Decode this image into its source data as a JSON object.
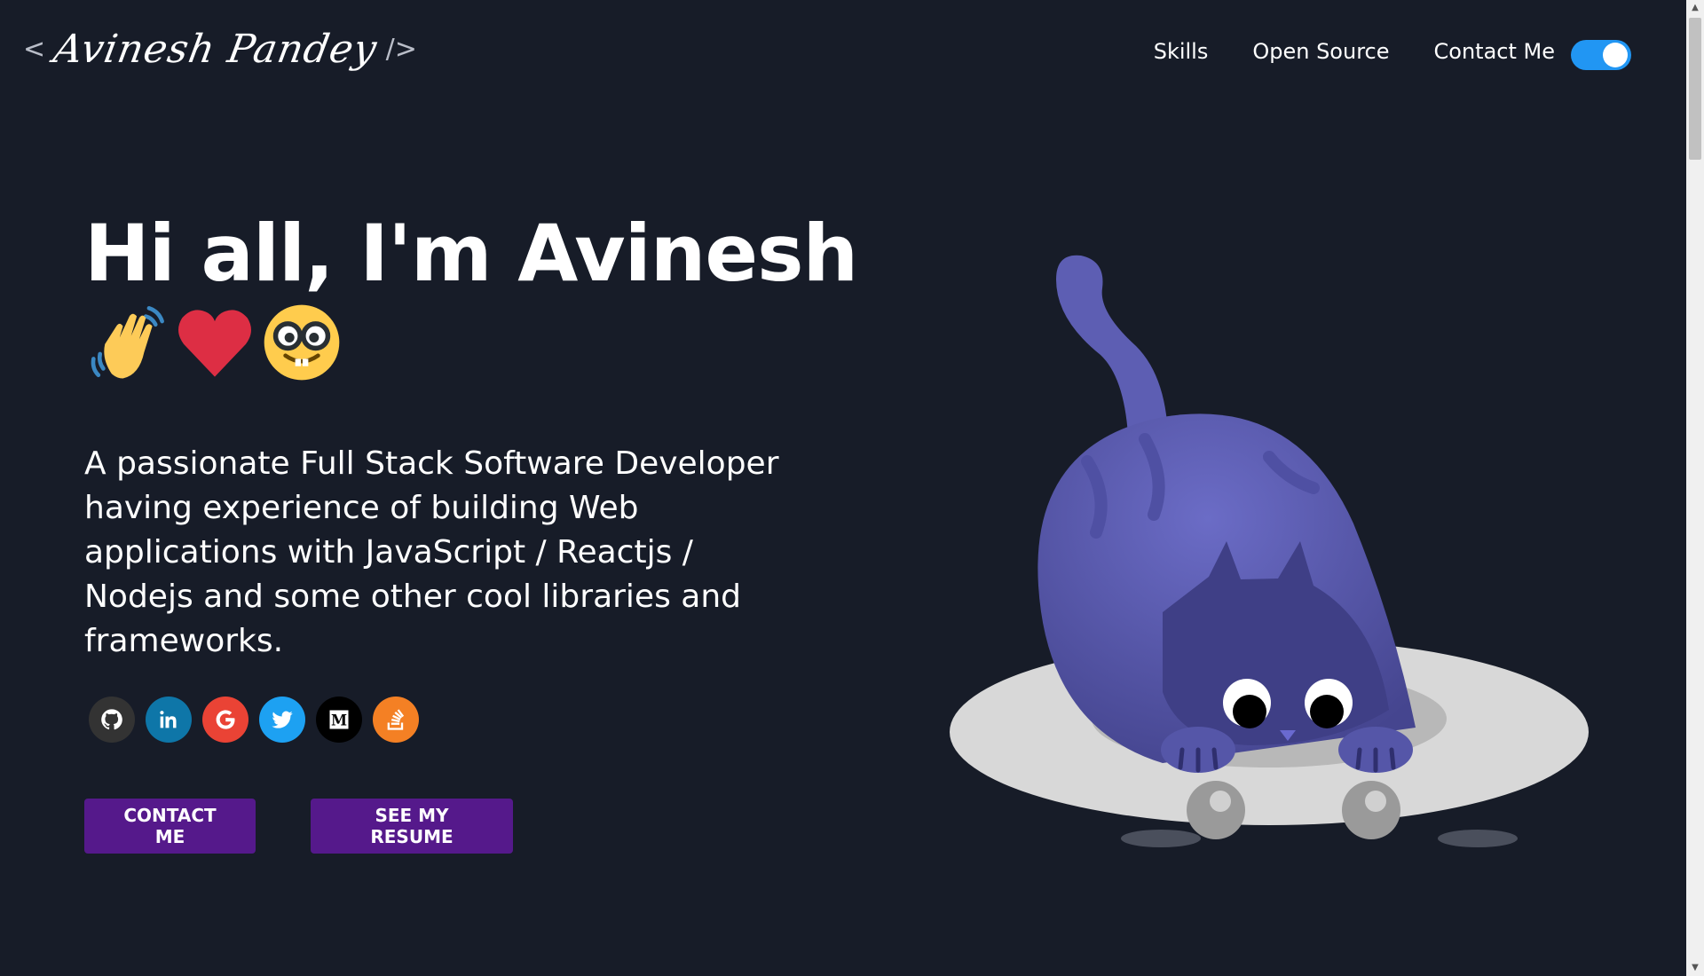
{
  "header": {
    "logo_open": "<",
    "logo_name": "Avinesh Pandey",
    "logo_close": "/>",
    "nav": [
      "Skills",
      "Open Source",
      "Contact Me"
    ],
    "theme_toggle": "on"
  },
  "hero": {
    "greeting": "Hi all, I'm Avinesh",
    "emojis": [
      "waving-hand",
      "red-heart",
      "nerd-face"
    ],
    "subtitle": "A passionate Full Stack Software Developer having experience of building Web applications with JavaScript / Reactjs / Nodejs and some other cool libraries and frameworks.",
    "socials": [
      {
        "name": "github",
        "color": "#333333"
      },
      {
        "name": "linkedin",
        "color": "#0e76a8"
      },
      {
        "name": "google",
        "color": "#ea4335"
      },
      {
        "name": "twitter",
        "color": "#1da1f2"
      },
      {
        "name": "medium",
        "color": "#000000"
      },
      {
        "name": "stack-overflow",
        "color": "#f48024"
      }
    ],
    "buttons": {
      "contact": "CONTACT ME",
      "resume": "SEE MY RESUME"
    }
  },
  "theme": {
    "background": "#171c28",
    "accent": "#55198b",
    "toggle": "#2196f3"
  }
}
